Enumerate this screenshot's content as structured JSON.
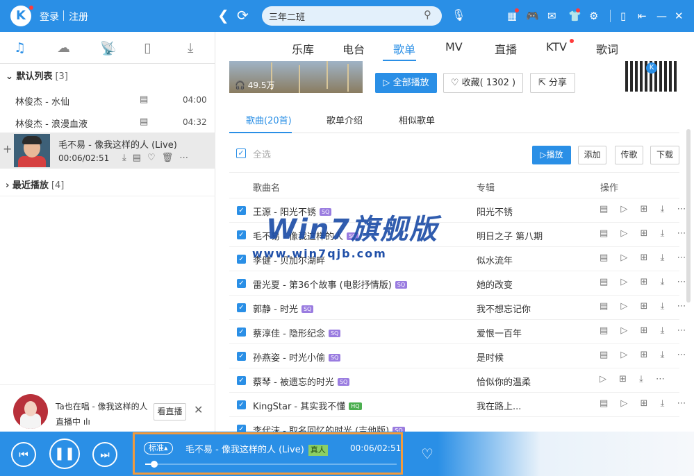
{
  "topbar": {
    "logo": "K",
    "login": "登录",
    "register": "注册",
    "search_value": "三年二班",
    "icons": [
      "back-arrow-icon",
      "refresh-icon",
      "search-icon",
      "mic-icon",
      "apps-icon",
      "gamepad-icon",
      "mail-icon",
      "shirt-icon",
      "gear-icon",
      "phone-icon",
      "mini-mode-icon",
      "minimize-icon",
      "close-icon"
    ]
  },
  "left": {
    "tabs": [
      "music-note-icon",
      "cloud-icon",
      "radio-icon",
      "device-icon",
      "download-icon"
    ],
    "default_list": {
      "label": "默认列表",
      "count": "[3]"
    },
    "songs": [
      {
        "title": "林俊杰 - 水仙",
        "duration": "04:00"
      },
      {
        "title": "林俊杰 - 浪漫血液",
        "duration": "04:32"
      }
    ],
    "current": {
      "title": "毛不易 - 像我这样的人 (Live)",
      "time": "00:06/02:51"
    },
    "recent": {
      "label": "最近播放",
      "count": "[4]"
    },
    "live": {
      "title": "Ta也在唱 - 像我这样的人",
      "status": "直播中",
      "watch_button": "看直播"
    }
  },
  "main": {
    "tabs": [
      {
        "label": "乐库",
        "active": false
      },
      {
        "label": "电台",
        "active": false
      },
      {
        "label": "歌单",
        "active": true
      },
      {
        "label": "MV",
        "active": false
      },
      {
        "label": "直播",
        "active": false
      },
      {
        "label": "KTV",
        "active": false
      },
      {
        "label": "歌词",
        "active": false
      }
    ],
    "cover_plays": "49.5万",
    "play_all": "全部播放",
    "favorite": "收藏( 1302 )",
    "share": "分享",
    "sub_tabs": [
      "歌曲(20首)",
      "歌单介绍",
      "相似歌单"
    ],
    "select_all": "全选",
    "toolbar": {
      "play": "播放",
      "add": "添加",
      "upload": "传歌",
      "download": "下载"
    },
    "columns": {
      "name": "歌曲名",
      "album": "专辑",
      "ops": "操作"
    },
    "rows": [
      {
        "title": "王源 - 阳光不锈",
        "quality": "SQ",
        "album": "阳光不锈",
        "acts": "▤ ▷ ⊞ ⤓ ⋯"
      },
      {
        "title": "毛不易 - 像我这样的人",
        "quality": "SQ",
        "album": "明日之子 第八期",
        "acts": "▤ ▷ ⊞ ⤓ ⋯"
      },
      {
        "title": "李健 - 贝加尔湖畔",
        "quality": "",
        "album": "似水流年",
        "acts": "▤ ▷ ⊞ ⤓ ⋯"
      },
      {
        "title": "雷光夏 - 第36个故事 (电影抒情版)",
        "quality": "SQ",
        "album": "她的改变",
        "acts": "▤ ▷ ⊞ ⤓ ⋯"
      },
      {
        "title": "郭静 - 时光",
        "quality": "SQ",
        "album": "我不想忘记你",
        "acts": "▤ ▷ ⊞ ⤓ ⋯"
      },
      {
        "title": "蔡淳佳 - 隐形纪念",
        "quality": "SQ",
        "album": "爱恨一百年",
        "acts": "▤ ▷ ⊞ ⤓ ⋯"
      },
      {
        "title": "孙燕姿 - 时光小偷",
        "quality": "SQ",
        "album": "是时候",
        "acts": "▤ ▷ ⊞ ⤓ ⋯"
      },
      {
        "title": "蔡琴 - 被遗忘的时光",
        "quality": "SQ",
        "album": "恰似你的温柔",
        "acts": "▷ ⊞ ⤓ ⋯"
      },
      {
        "title": "KingStar - 其实我不懂",
        "quality": "HQ",
        "album": "我在路上...",
        "acts": "▤ ▷ ⊞ ⤓ ⋯"
      },
      {
        "title": "李代沫 - 取名回忆的时光 (吉他版)",
        "quality": "SQ",
        "album": "",
        "acts": ""
      }
    ]
  },
  "watermark": {
    "brand": "Win7旗舰版",
    "url": "www.win7qjb.com"
  },
  "player": {
    "quality": "标准",
    "title": "毛不易 - 像我这样的人 (Live)",
    "badge": "真人",
    "time": "00:06/02:51",
    "progress_fraction": 0.035
  }
}
